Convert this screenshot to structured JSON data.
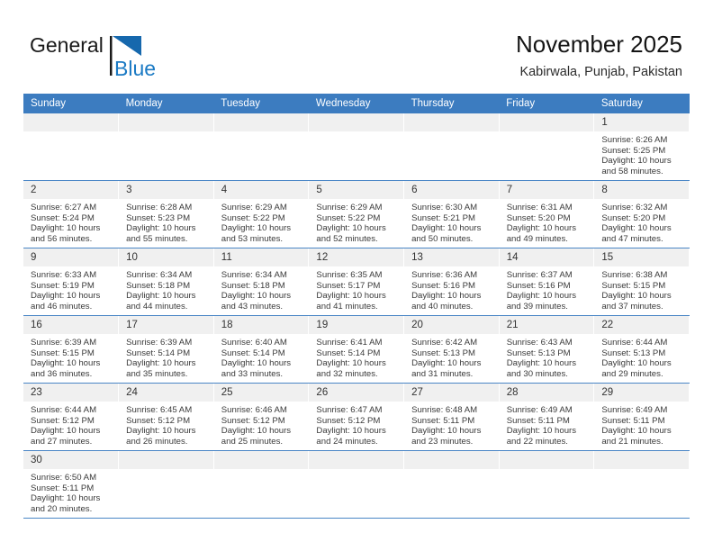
{
  "brand": {
    "name_top": "General",
    "name_bottom": "Blue",
    "color_top": "#1a1a1a",
    "color_bottom": "#1b7ac4",
    "triangle_color": "#1668ad"
  },
  "header": {
    "title": "November 2025",
    "subtitle": "Kabirwala, Punjab, Pakistan"
  },
  "colors": {
    "header_bar": "#3c7cc0",
    "daynum_band": "#f0f0f0",
    "row_divider": "#4a86c6",
    "text": "#3a3a3a"
  },
  "weekdays": [
    "Sunday",
    "Monday",
    "Tuesday",
    "Wednesday",
    "Thursday",
    "Friday",
    "Saturday"
  ],
  "labels": {
    "sunrise": "Sunrise:",
    "sunset": "Sunset:",
    "daylight": "Daylight:"
  },
  "weeks": [
    [
      {
        "day": "",
        "empty": true
      },
      {
        "day": "",
        "empty": true
      },
      {
        "day": "",
        "empty": true
      },
      {
        "day": "",
        "empty": true
      },
      {
        "day": "",
        "empty": true
      },
      {
        "day": "",
        "empty": true
      },
      {
        "day": "1",
        "sunrise": "Sunrise: 6:26 AM",
        "sunset": "Sunset: 5:25 PM",
        "daylight": "Daylight: 10 hours and 58 minutes."
      }
    ],
    [
      {
        "day": "2",
        "sunrise": "Sunrise: 6:27 AM",
        "sunset": "Sunset: 5:24 PM",
        "daylight": "Daylight: 10 hours and 56 minutes."
      },
      {
        "day": "3",
        "sunrise": "Sunrise: 6:28 AM",
        "sunset": "Sunset: 5:23 PM",
        "daylight": "Daylight: 10 hours and 55 minutes."
      },
      {
        "day": "4",
        "sunrise": "Sunrise: 6:29 AM",
        "sunset": "Sunset: 5:22 PM",
        "daylight": "Daylight: 10 hours and 53 minutes."
      },
      {
        "day": "5",
        "sunrise": "Sunrise: 6:29 AM",
        "sunset": "Sunset: 5:22 PM",
        "daylight": "Daylight: 10 hours and 52 minutes."
      },
      {
        "day": "6",
        "sunrise": "Sunrise: 6:30 AM",
        "sunset": "Sunset: 5:21 PM",
        "daylight": "Daylight: 10 hours and 50 minutes."
      },
      {
        "day": "7",
        "sunrise": "Sunrise: 6:31 AM",
        "sunset": "Sunset: 5:20 PM",
        "daylight": "Daylight: 10 hours and 49 minutes."
      },
      {
        "day": "8",
        "sunrise": "Sunrise: 6:32 AM",
        "sunset": "Sunset: 5:20 PM",
        "daylight": "Daylight: 10 hours and 47 minutes."
      }
    ],
    [
      {
        "day": "9",
        "sunrise": "Sunrise: 6:33 AM",
        "sunset": "Sunset: 5:19 PM",
        "daylight": "Daylight: 10 hours and 46 minutes."
      },
      {
        "day": "10",
        "sunrise": "Sunrise: 6:34 AM",
        "sunset": "Sunset: 5:18 PM",
        "daylight": "Daylight: 10 hours and 44 minutes."
      },
      {
        "day": "11",
        "sunrise": "Sunrise: 6:34 AM",
        "sunset": "Sunset: 5:18 PM",
        "daylight": "Daylight: 10 hours and 43 minutes."
      },
      {
        "day": "12",
        "sunrise": "Sunrise: 6:35 AM",
        "sunset": "Sunset: 5:17 PM",
        "daylight": "Daylight: 10 hours and 41 minutes."
      },
      {
        "day": "13",
        "sunrise": "Sunrise: 6:36 AM",
        "sunset": "Sunset: 5:16 PM",
        "daylight": "Daylight: 10 hours and 40 minutes."
      },
      {
        "day": "14",
        "sunrise": "Sunrise: 6:37 AM",
        "sunset": "Sunset: 5:16 PM",
        "daylight": "Daylight: 10 hours and 39 minutes."
      },
      {
        "day": "15",
        "sunrise": "Sunrise: 6:38 AM",
        "sunset": "Sunset: 5:15 PM",
        "daylight": "Daylight: 10 hours and 37 minutes."
      }
    ],
    [
      {
        "day": "16",
        "sunrise": "Sunrise: 6:39 AM",
        "sunset": "Sunset: 5:15 PM",
        "daylight": "Daylight: 10 hours and 36 minutes."
      },
      {
        "day": "17",
        "sunrise": "Sunrise: 6:39 AM",
        "sunset": "Sunset: 5:14 PM",
        "daylight": "Daylight: 10 hours and 35 minutes."
      },
      {
        "day": "18",
        "sunrise": "Sunrise: 6:40 AM",
        "sunset": "Sunset: 5:14 PM",
        "daylight": "Daylight: 10 hours and 33 minutes."
      },
      {
        "day": "19",
        "sunrise": "Sunrise: 6:41 AM",
        "sunset": "Sunset: 5:14 PM",
        "daylight": "Daylight: 10 hours and 32 minutes."
      },
      {
        "day": "20",
        "sunrise": "Sunrise: 6:42 AM",
        "sunset": "Sunset: 5:13 PM",
        "daylight": "Daylight: 10 hours and 31 minutes."
      },
      {
        "day": "21",
        "sunrise": "Sunrise: 6:43 AM",
        "sunset": "Sunset: 5:13 PM",
        "daylight": "Daylight: 10 hours and 30 minutes."
      },
      {
        "day": "22",
        "sunrise": "Sunrise: 6:44 AM",
        "sunset": "Sunset: 5:13 PM",
        "daylight": "Daylight: 10 hours and 29 minutes."
      }
    ],
    [
      {
        "day": "23",
        "sunrise": "Sunrise: 6:44 AM",
        "sunset": "Sunset: 5:12 PM",
        "daylight": "Daylight: 10 hours and 27 minutes."
      },
      {
        "day": "24",
        "sunrise": "Sunrise: 6:45 AM",
        "sunset": "Sunset: 5:12 PM",
        "daylight": "Daylight: 10 hours and 26 minutes."
      },
      {
        "day": "25",
        "sunrise": "Sunrise: 6:46 AM",
        "sunset": "Sunset: 5:12 PM",
        "daylight": "Daylight: 10 hours and 25 minutes."
      },
      {
        "day": "26",
        "sunrise": "Sunrise: 6:47 AM",
        "sunset": "Sunset: 5:12 PM",
        "daylight": "Daylight: 10 hours and 24 minutes."
      },
      {
        "day": "27",
        "sunrise": "Sunrise: 6:48 AM",
        "sunset": "Sunset: 5:11 PM",
        "daylight": "Daylight: 10 hours and 23 minutes."
      },
      {
        "day": "28",
        "sunrise": "Sunrise: 6:49 AM",
        "sunset": "Sunset: 5:11 PM",
        "daylight": "Daylight: 10 hours and 22 minutes."
      },
      {
        "day": "29",
        "sunrise": "Sunrise: 6:49 AM",
        "sunset": "Sunset: 5:11 PM",
        "daylight": "Daylight: 10 hours and 21 minutes."
      }
    ],
    [
      {
        "day": "30",
        "sunrise": "Sunrise: 6:50 AM",
        "sunset": "Sunset: 5:11 PM",
        "daylight": "Daylight: 10 hours and 20 minutes."
      },
      {
        "day": "",
        "empty": true
      },
      {
        "day": "",
        "empty": true
      },
      {
        "day": "",
        "empty": true
      },
      {
        "day": "",
        "empty": true
      },
      {
        "day": "",
        "empty": true
      },
      {
        "day": "",
        "empty": true
      }
    ]
  ]
}
